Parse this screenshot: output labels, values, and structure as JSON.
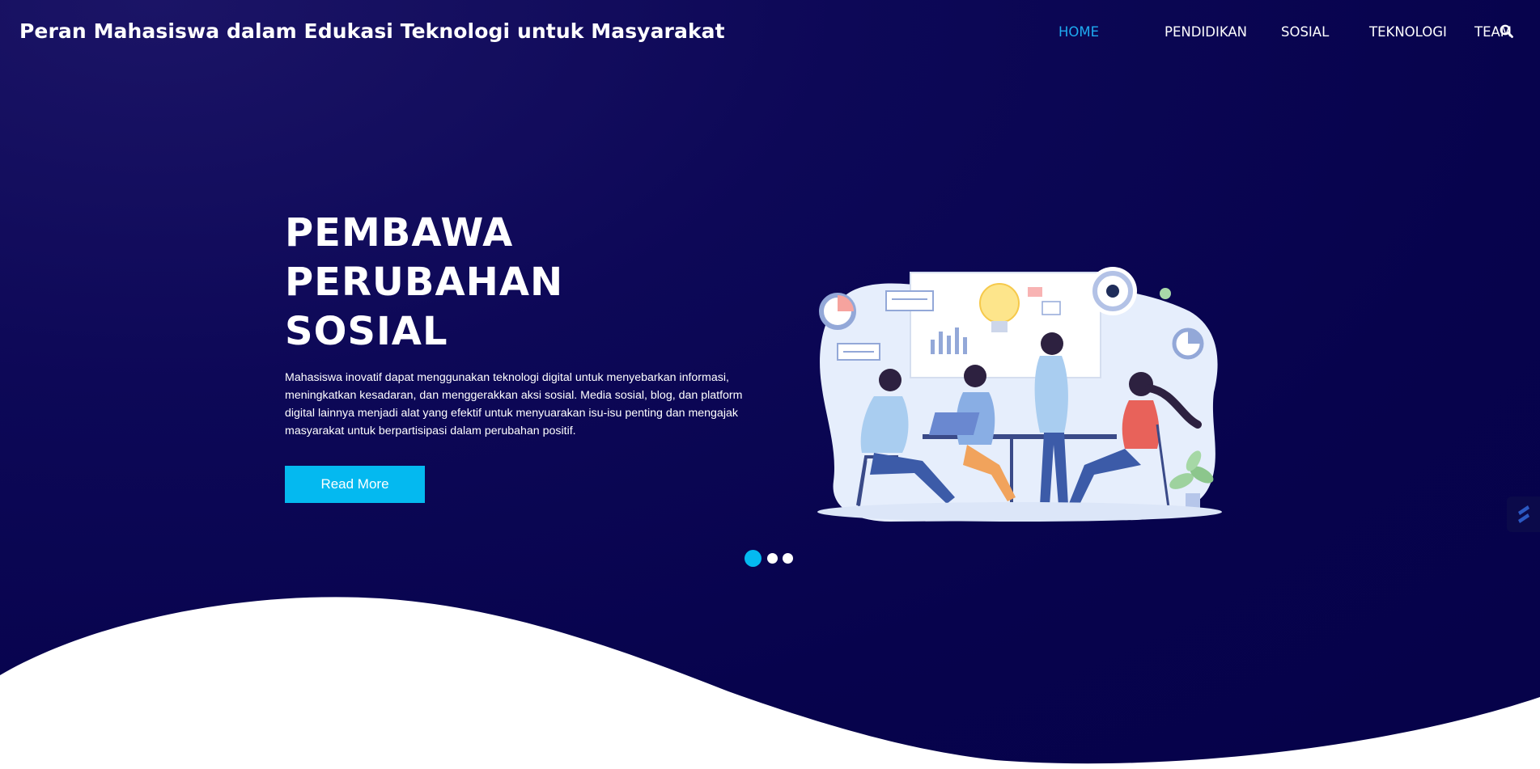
{
  "site": {
    "title": "Peran Mahasiswa dalam Edukasi Teknologi untuk Masyarakat"
  },
  "nav": {
    "items": [
      {
        "label": "HOME",
        "active": true
      },
      {
        "label": "PENDIDIKAN",
        "active": false
      },
      {
        "label": "SOSIAL",
        "active": false
      },
      {
        "label": "TEKNOLOGI",
        "active": false
      },
      {
        "label": "TEAM",
        "active": false
      }
    ],
    "search_icon": "search-icon"
  },
  "hero": {
    "title_lines": [
      "PEMBAWA",
      "PERUBAHAN",
      "SOSIAL"
    ],
    "paragraph": "Mahasiswa inovatif dapat menggunakan teknologi digital untuk menyebarkan informasi, meningkatkan kesadaran, dan menggerakkan aksi sosial. Media sosial, blog, dan platform digital lainnya menjadi alat yang efektif untuk menyuarakan isu-isu penting dan mengajak masyarakat untuk berpartisipasi dalam perubahan positif.",
    "button_label": "Read More",
    "illustration": "team-meeting-illustration"
  },
  "slider": {
    "total": 3,
    "active_index": 0
  },
  "colors": {
    "background": "#0d0857",
    "accent": "#04b9f0",
    "nav_active": "#1eaaf1",
    "text": "#ffffff"
  }
}
